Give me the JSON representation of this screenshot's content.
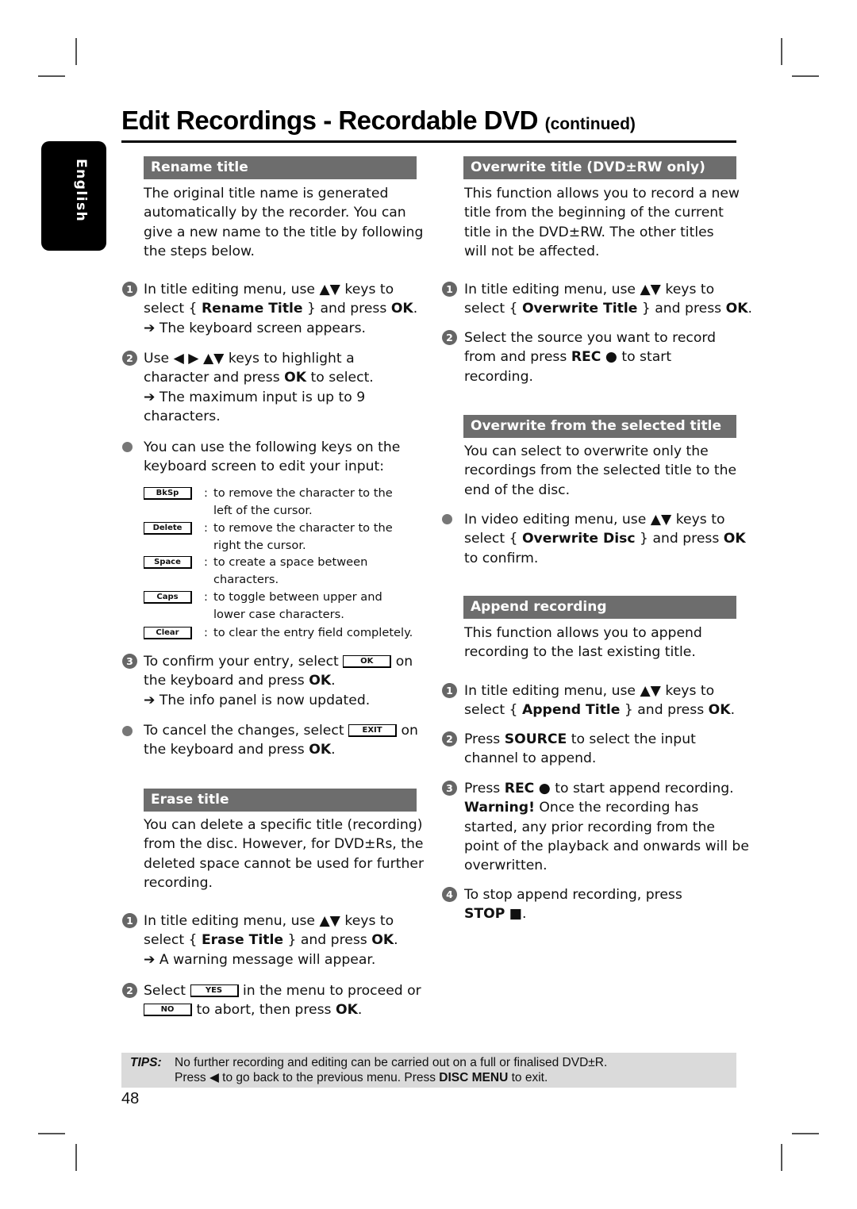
{
  "page": {
    "title": "Edit Recordings - Recordable DVD",
    "title_suffix": "(continued)",
    "language_tab": "English",
    "page_number": "48"
  },
  "symbols": {
    "up_down": "▲▼",
    "left_right": "◀ ▶",
    "left": "◀",
    "arrow": "➔",
    "rec": "●",
    "stop": "■"
  },
  "rename_title": {
    "header": "Rename title",
    "intro": [
      "The original title name is generated",
      "automatically by the recorder. You can",
      "give a new name to the title by following",
      "the steps below."
    ],
    "step1": {
      "num": "1",
      "l1_a": "In title editing menu, use ",
      "l1_b": " keys to",
      "l2_a": "select { ",
      "l2_bold": "Rename Title",
      "l2_b": " } and press ",
      "l2_ok": "OK",
      "l2_c": ".",
      "result": " The keyboard screen appears."
    },
    "step2": {
      "num": "2",
      "l1_a": "Use ",
      "l1_b": " keys to highlight a",
      "l2_a": "character and press ",
      "l2_ok": "OK",
      "l2_b": " to select.",
      "result": " The maximum input is up to 9",
      "result2": "characters."
    },
    "bullet": [
      "You can use the following keys on the",
      "keyboard screen to edit your input:"
    ],
    "keys": [
      {
        "key": "BkSp",
        "desc": [
          "to remove the character to the",
          "left of the cursor."
        ]
      },
      {
        "key": "Delete",
        "desc": [
          "to remove the character to the",
          "right the cursor."
        ]
      },
      {
        "key": "Space",
        "desc": [
          "to create a space between",
          "characters."
        ]
      },
      {
        "key": "Caps",
        "desc": [
          "to toggle between upper and",
          "lower case characters."
        ]
      },
      {
        "key": "Clear",
        "desc": [
          "to clear the entry field completely."
        ]
      }
    ],
    "step3": {
      "num": "3",
      "l1_a": "To confirm your entry, select ",
      "key": "OK",
      "l1_b": " on",
      "l2_a": "the keyboard and press ",
      "l2_ok": "OK",
      "l2_b": ".",
      "result": " The info panel is now updated."
    },
    "cancel": {
      "l1_a": "To cancel the changes, select ",
      "key": "EXIT",
      "l1_b": " on",
      "l2_a": "the keyboard and press ",
      "l2_ok": "OK",
      "l2_b": "."
    }
  },
  "erase_title": {
    "header": "Erase title",
    "intro": [
      "You can delete a specific title (recording)",
      "from the disc. However, for DVD±Rs, the",
      "deleted space cannot be used for further",
      "recording."
    ],
    "step1": {
      "num": "1",
      "l1_a": "In title editing menu, use ",
      "l1_b": " keys to",
      "l2_a": "select { ",
      "l2_bold": "Erase Title",
      "l2_b": " } and press ",
      "l2_ok": "OK",
      "l2_c": ".",
      "result": " A warning message will appear."
    },
    "step2": {
      "num": "2",
      "l1_a": "Select ",
      "key_yes": "YES",
      "l1_b": " in the menu to proceed or",
      "key_no": "NO",
      "l2_a": " to abort, then press ",
      "l2_ok": "OK",
      "l2_b": "."
    }
  },
  "overwrite_title": {
    "header": "Overwrite title (DVD±RW only)",
    "intro": [
      "This function allows you to record a new",
      "title from the beginning of the current",
      "title in the DVD±RW. The other titles",
      "will not be affected."
    ],
    "step1": {
      "num": "1",
      "l1_a": "In title editing menu, use ",
      "l1_b": " keys to",
      "l2_a": "select { ",
      "l2_bold": "Overwrite Title",
      "l2_b": " } and press ",
      "l2_ok": "OK",
      "l2_c": "."
    },
    "step2": {
      "num": "2",
      "l1": "Select the source you want to record",
      "l2_a": "from and press ",
      "l2_rec": "REC",
      "l2_b": " to start",
      "l3": "recording."
    }
  },
  "overwrite_from": {
    "header": "Overwrite from the selected title",
    "intro": [
      "You can select to overwrite only the",
      "recordings from the selected title to the",
      "end of the disc."
    ],
    "bullet": {
      "l1_a": "In video editing menu, use ",
      "l1_b": " keys to",
      "l2_a": "select { ",
      "l2_bold": "Overwrite Disc",
      "l2_b": " } and press ",
      "l2_ok": "OK",
      "l3": "to confirm."
    }
  },
  "append_recording": {
    "header": "Append recording",
    "intro": [
      "This function allows you to append",
      "recording to the last existing title."
    ],
    "step1": {
      "num": "1",
      "l1_a": "In title editing menu, use ",
      "l1_b": " keys to",
      "l2_a": "select { ",
      "l2_bold": "Append Title",
      "l2_b": " } and press ",
      "l2_ok": "OK",
      "l2_c": "."
    },
    "step2": {
      "num": "2",
      "l1_a": "Press ",
      "l1_bold": "SOURCE",
      "l1_b": " to select the input",
      "l2": "channel to append."
    },
    "step3": {
      "num": "3",
      "l1_a": "Press ",
      "l1_bold": "REC",
      "l1_b": " to start append recording.",
      "l2_bold": "Warning!",
      "l2_b": " Once the recording has",
      "l3": "started, any prior recording from the",
      "l4": "point of the playback and onwards will be",
      "l5": "overwritten."
    },
    "step4": {
      "num": "4",
      "l1": "To stop append recording, press",
      "l2_bold": "STOP",
      "l2_b": "."
    }
  },
  "tips": {
    "label": "TIPS:",
    "line1": "No further recording and editing can be carried out on a full or finalised DVD±R.",
    "line2_a": "Press ",
    "line2_b": " to go back to the previous menu. Press ",
    "line2_bold": "DISC MENU",
    "line2_c": " to exit."
  }
}
